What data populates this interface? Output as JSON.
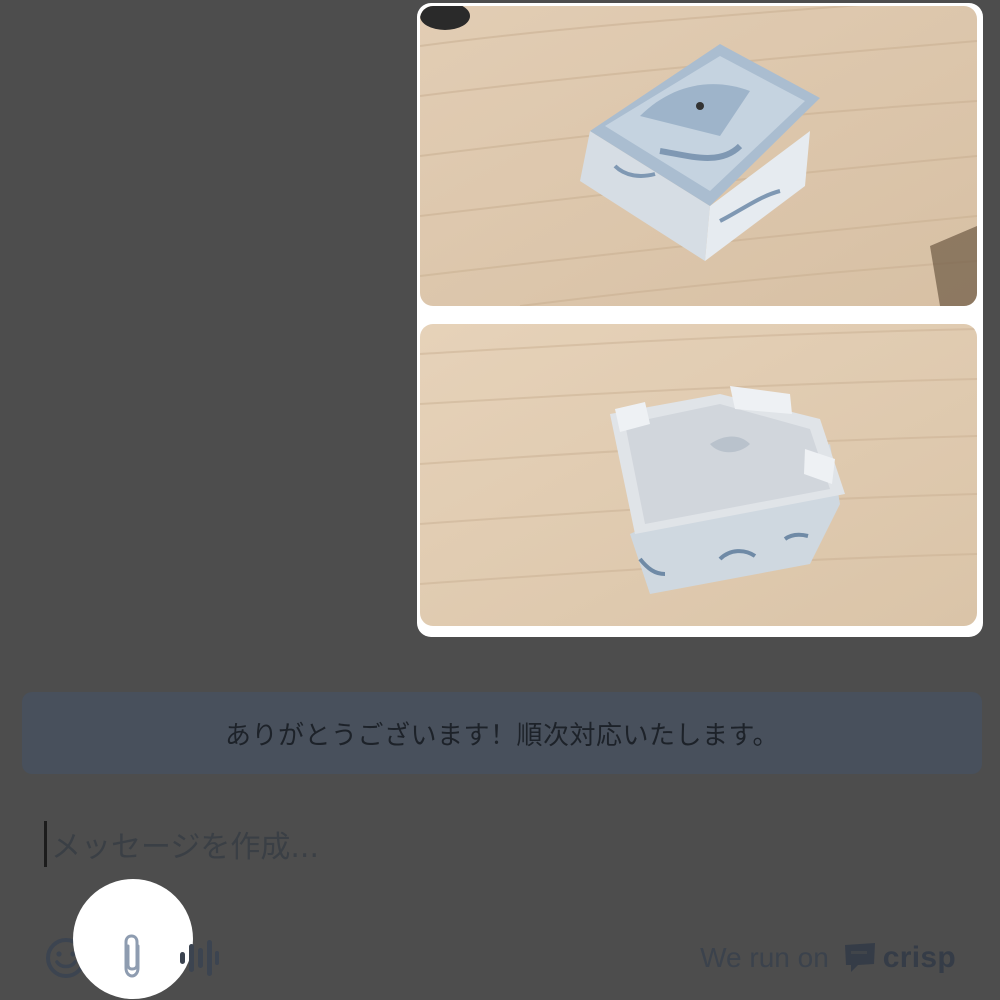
{
  "attachments": {
    "images": [
      {
        "alt": ""
      },
      {
        "alt": ""
      }
    ]
  },
  "conversation": {
    "operator_reply": "ありがとうございます！順次対応いたします。"
  },
  "composer": {
    "placeholder": "メッセージを作成..."
  },
  "toolbar": {
    "emoji_icon": "smiley-icon",
    "attach_icon": "paperclip-icon",
    "audio_icon": "microphone-waveform-icon"
  },
  "footer": {
    "powered_by": "We run on",
    "brand": "crisp"
  },
  "colors": {
    "overlay": "#4d4d4d",
    "bubble": "#48505c",
    "card": "#ffffff",
    "icon": "#8e9cb0"
  }
}
